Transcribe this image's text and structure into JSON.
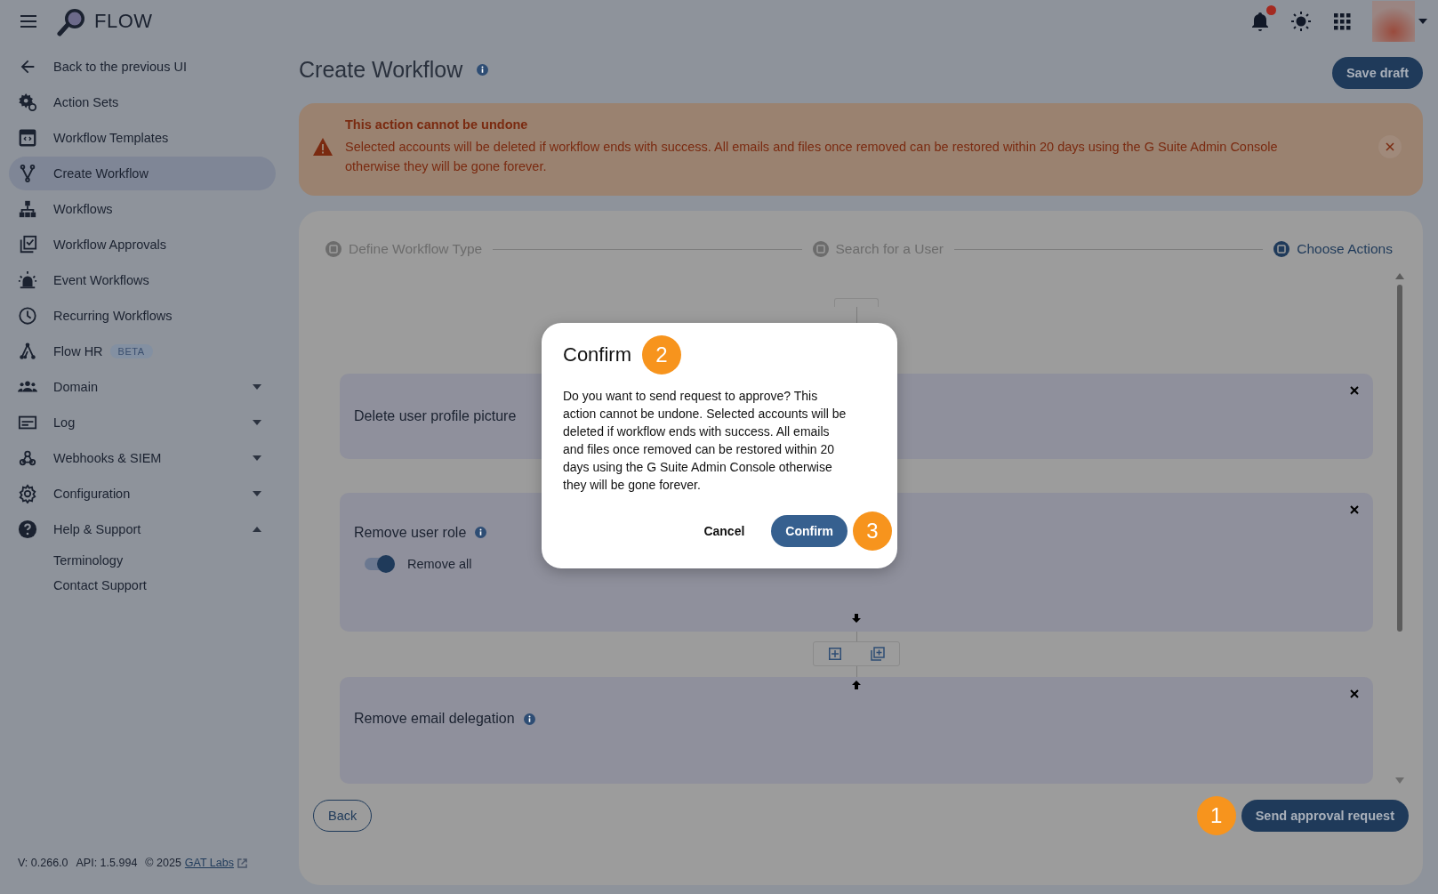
{
  "header": {
    "app_name": "FLOW",
    "notifications_unread": true
  },
  "sidebar": {
    "items": [
      {
        "label": "Back to the previous UI",
        "selected": false
      },
      {
        "label": "Action Sets",
        "selected": false
      },
      {
        "label": "Workflow Templates",
        "selected": false
      },
      {
        "label": "Create Workflow",
        "selected": true
      },
      {
        "label": "Workflows",
        "selected": false
      },
      {
        "label": "Workflow Approvals",
        "selected": false
      },
      {
        "label": "Event Workflows",
        "selected": false
      },
      {
        "label": "Recurring Workflows",
        "selected": false
      },
      {
        "label": "Flow HR",
        "selected": false,
        "badge": "BETA"
      },
      {
        "label": "Domain",
        "selected": false,
        "expanded": false
      },
      {
        "label": "Log",
        "selected": false,
        "expanded": false
      },
      {
        "label": "Webhooks & SIEM",
        "selected": false,
        "expanded": false
      },
      {
        "label": "Configuration",
        "selected": false,
        "expanded": false
      },
      {
        "label": "Help & Support",
        "selected": false,
        "expanded": true,
        "children": [
          {
            "label": "Terminology"
          },
          {
            "label": "Contact Support"
          }
        ]
      }
    ],
    "footer": {
      "version": "V: 0.266.0",
      "api": "API: 1.5.994",
      "copyright": "© 2025",
      "link": "GAT Labs"
    }
  },
  "page": {
    "title": "Create Workflow",
    "save_button": "Save draft"
  },
  "alert": {
    "title": "This action cannot be undone",
    "message": "Selected accounts will be deleted if workflow ends with success. All emails and files once removed can be restored within 20 days using the G Suite Admin Console otherwise they will be gone forever."
  },
  "stepper": {
    "steps": [
      {
        "label": "Define Workflow Type",
        "selected": false
      },
      {
        "label": "Search for a User",
        "selected": false
      },
      {
        "label": "Choose Actions",
        "selected": true
      }
    ]
  },
  "actions": [
    {
      "title": "Delete user profile picture",
      "info": false
    },
    {
      "title": "Remove user role",
      "info": true,
      "option": {
        "label": "Remove all",
        "on": true
      }
    },
    {
      "title": "Remove email delegation",
      "info": true
    }
  ],
  "footer_buttons": {
    "back": "Back",
    "send": "Send approval request",
    "send_marker": "1"
  },
  "dialog": {
    "title": "Confirm",
    "title_marker": "2",
    "message": "Do you want to send request to approve? This action cannot be undone. Selected accounts will be deleted if workflow ends with success. All emails and files once removed can be restored within 20 days using the G Suite Admin Console otherwise they will be gone forever.",
    "cancel": "Cancel",
    "confirm": "Confirm",
    "confirm_marker": "3"
  }
}
